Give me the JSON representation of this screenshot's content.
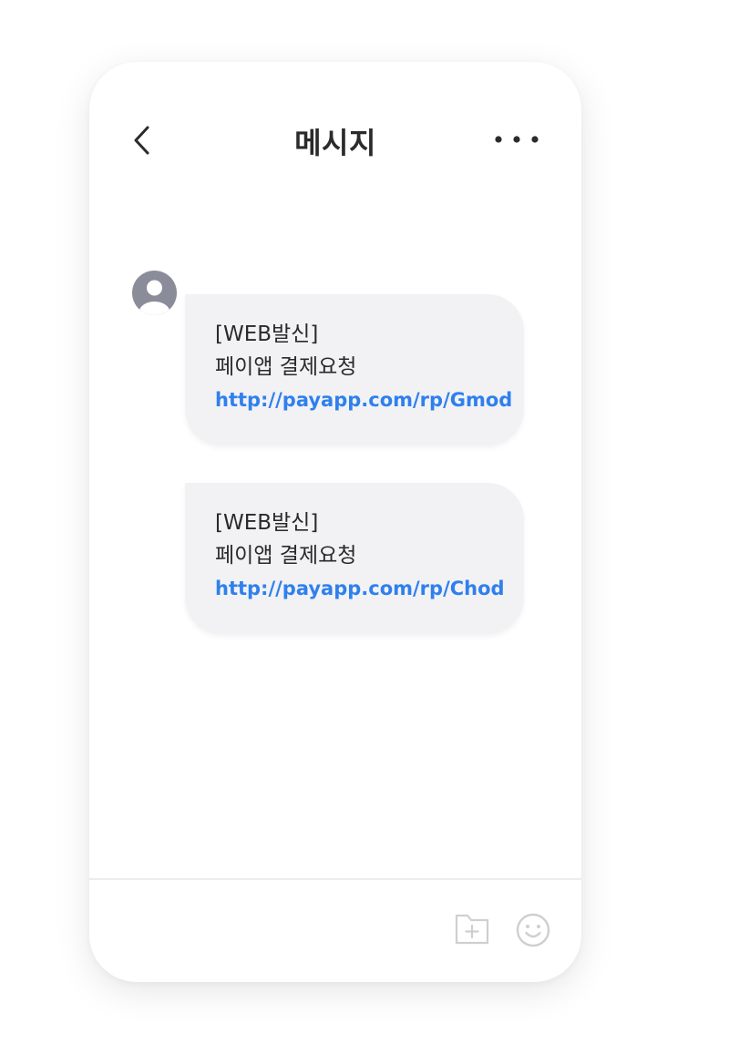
{
  "header": {
    "title": "메시지",
    "back_icon": "chevron-left-icon",
    "more_icon": "more-horizontal-icon"
  },
  "messages": [
    {
      "line1": "[WEB발신]",
      "line2": "페이앱 결제요청",
      "link": "http://payapp.com/rp/Gmod"
    },
    {
      "line1": "[WEB발신]",
      "line2": "페이앱 결제요청",
      "link": "http://payapp.com/rp/Chod"
    }
  ],
  "input_bar": {
    "attach_icon": "folder-add-icon",
    "emoji_icon": "smiley-icon"
  },
  "colors": {
    "bubble_bg": "#f2f2f4",
    "link": "#2f80ed",
    "avatar": "#8a8c99",
    "icon_gray": "#cfcfcf"
  }
}
